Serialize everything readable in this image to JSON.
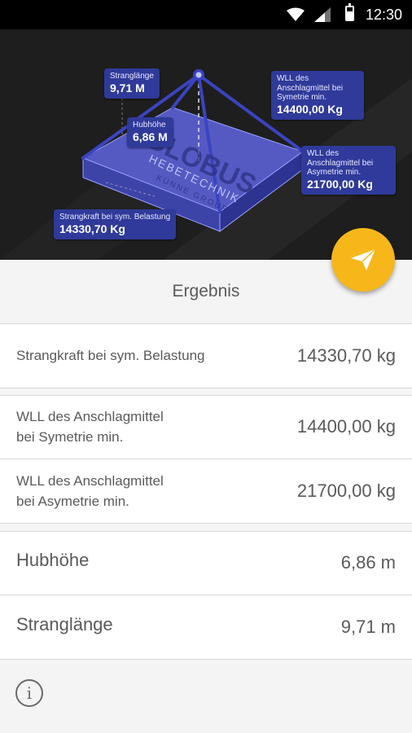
{
  "status_bar": {
    "time": "12:30"
  },
  "diagram": {
    "brand_logo": "GLOBUS",
    "brand_sub1": "HEBETECHNIK",
    "brand_sub2": "KÜNNE GROUP",
    "bubbles": {
      "stranglaenge": {
        "label": "Stranglänge",
        "value": "9,71 M"
      },
      "hubhoehe": {
        "label": "Hubhöhe",
        "value": "6,86 M"
      },
      "wll_sym": {
        "label": "WLL des Anschlagmittel bei Symetrie min.",
        "value": "14400,00 Kg"
      },
      "wll_asym": {
        "label": "WLL des Anschlagmittel bei Asymetrie min.",
        "value": "21700,00 Kg"
      },
      "strangkraft": {
        "label": "Strangkraft bei sym. Belastung",
        "value": "14330,70 Kg"
      }
    },
    "colors": {
      "accent": "#2f3a9a",
      "load": "#5a62d8",
      "fab": "#f7b71a"
    }
  },
  "fab": {
    "icon": "send-icon"
  },
  "result": {
    "title": "Ergebnis",
    "rows": [
      {
        "label": "Strangkraft bei sym. Belastung",
        "value": "14330,70 kg"
      },
      {
        "label_line1": "WLL des Anschlagmittel",
        "label_line2": "bei Symetrie min.",
        "value": "14400,00 kg"
      },
      {
        "label_line1": "WLL des Anschlagmittel",
        "label_line2": "bei Asymetrie min.",
        "value": "21700,00 kg"
      },
      {
        "label": "Hubhöhe",
        "value": "6,86 m"
      },
      {
        "label": "Stranglänge",
        "value": "9,71 m"
      }
    ]
  },
  "footer": {
    "info_icon": "info-icon",
    "info_glyph": "i"
  }
}
